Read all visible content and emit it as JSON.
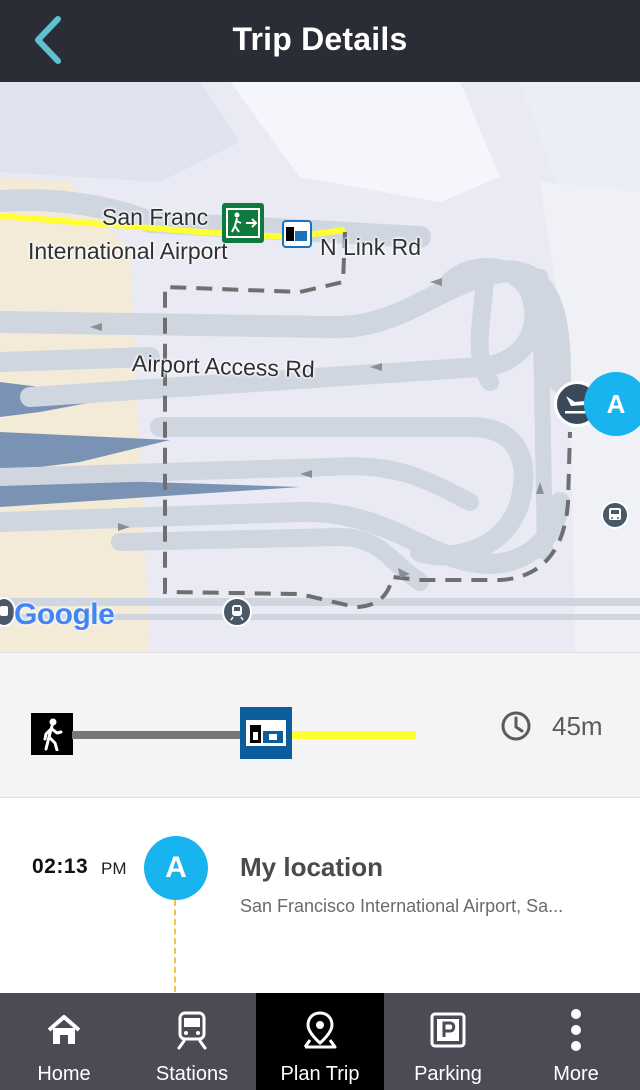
{
  "header": {
    "title": "Trip Details",
    "back_icon": "chevron-left-icon",
    "back_color": "#5ec3cf"
  },
  "map": {
    "labels": {
      "airport_line1": "San Franc",
      "airport_line2": "International Airport",
      "road_n_link": "N Link Rd",
      "road_access": "Airport Access Rd"
    },
    "attribution": "Google",
    "pin_label": "A",
    "route_colors": {
      "bart": "#ffff33",
      "walk_dashed": "#6f6f6f"
    }
  },
  "summary": {
    "mode_icons": [
      "walk-icon",
      "bart-icon"
    ],
    "segment_colors": [
      "#777777",
      "#ffff2e"
    ],
    "duration": "45m"
  },
  "step": {
    "time": "02:13",
    "ampm": "PM",
    "pin_label": "A",
    "title": "My location",
    "address": "San Francisco International Airport, Sa..."
  },
  "tabs": [
    {
      "label": "Home",
      "icon": "home-icon",
      "active": false
    },
    {
      "label": "Stations",
      "icon": "train-icon",
      "active": false
    },
    {
      "label": "Plan Trip",
      "icon": "map-pin-icon",
      "active": true
    },
    {
      "label": "Parking",
      "icon": "parking-icon",
      "active": false
    },
    {
      "label": "More",
      "icon": "more-vertical-icon",
      "active": false
    }
  ]
}
